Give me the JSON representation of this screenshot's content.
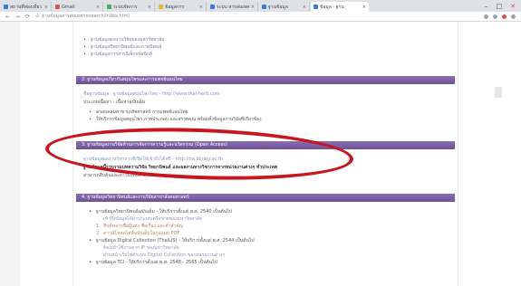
{
  "browser": {
    "tabs": [
      {
        "label": "สถานที่ท่องเที่ยว 2021 - X",
        "color": "#3b7bd8",
        "active": false
      },
      {
        "label": "Gmail",
        "color": "#d9534f",
        "active": false
      },
      {
        "label": "ระบบจัดการ",
        "color": "#4aa564",
        "active": false
      },
      {
        "label": "ข้อมูลการ",
        "color": "#f0b429",
        "active": false
      },
      {
        "label": "ระบบ สารสนเทศ",
        "color": "#3b7bd8",
        "active": false
      },
      {
        "label": "ฐานข้อมูล",
        "color": "#3b7bd8",
        "active": false
      },
      {
        "label": "ข้อมูล - ฐาน",
        "color": "#3b7bd8",
        "active": true
      }
    ],
    "url": "ฐานข้อมูลสารสนเทศ/research/index.html"
  },
  "top_bullets": [
    "ฐานข้อมูลผลงานวิจัยของมหาวิทยาลัย",
    "ฐานข้อมูลวิทยานิพนธ์และภาคนิพนธ์",
    "ฐานข้อมูลวารสารอิเล็กทรอนิกส์"
  ],
  "section1": {
    "header": "2. ฐานข้อมูลเกี่ยวกับสมุนไพรและการแพทย์แผนไทย",
    "line1": "ชื่อฐานข้อมูล : ฐานข้อมูลสมุนไพรไทย - http://www.thai-herb.com",
    "line2": "ประเภทเนื้อหา : เนื้อหาฉบับเต็ม",
    "bullets": [
      "ครอบคลุมสาขาเภสัชศาสตร์ การแพทย์แผนไทย",
      "ให้บริการข้อมูลสมุนไพร ภาพประกอบ และสรรพคุณ พร้อมทั้งข้อมูลงานวิจัยที่เกี่ยวข้อง"
    ]
  },
  "section2": {
    "header": "3. ฐานข้อมูลงานวิจัยด้านการจัดการความรู้และนวัตกรรม (Open Access)",
    "line1": "ฐานข้อมูลผลงานวิชาการที่เปิดให้เข้าถึงได้ฟรี - http://oa.library.ac.th",
    "line2": "ฐานข้อมูลนี้รวบรวมบทความวิจัย วิทยานิพนธ์ และผลงานทางวิชาการจากหน่วยงานต่างๆ ทั่วประเทศ",
    "line3": "สามารถสืบค้นและดาวน์โหลดได้ฟรี"
  },
  "section3": {
    "header": "4. ฐานข้อมูลวิทยานิพนธ์และงานวิจัยสาขาสังคมศาสตร์",
    "bullets": [
      {
        "text": "ฐานข้อมูลวิทยานิพนธ์ฉบับเต็ม - ให้บริการตั้งแต่ พ.ศ. 2540 เป็นต้นไป",
        "kind": "main"
      },
      {
        "text": "เข้าถึงข้อมูลได้ผ่านระบบเครือข่ายของมหาวิทยาลัย",
        "kind": "note"
      },
      {
        "text": "สืบค้นจากชื่อผู้แต่ง ชื่อเรื่อง และคำสำคัญ",
        "kind": "sub"
      },
      {
        "text": "ดาวน์โหลดไฟล์ฉบับเต็มในรูปแบบ PDF",
        "kind": "sub2"
      },
      {
        "text": "ฐานข้อมูล Digital Collection (ThaiLIS) - ให้บริการตั้งแต่ พ.ศ. 2544 เป็นต้นไป",
        "kind": "main"
      },
      {
        "text": "ต้องเข้าใช้งานจาก IP ของมหาวิทยาลัย",
        "kind": "note"
      },
      {
        "text": "ผ่านหน้าเว็บไซต์ระบบ Digital Collection ของหน่วยงานต่างๆ",
        "kind": "note"
      },
      {
        "text": "ฐานข้อมูล TCI - ให้บริการตั้งแต่ พ.ศ. 2548 - 2565 เป็นต้นไป",
        "kind": "main"
      }
    ]
  }
}
